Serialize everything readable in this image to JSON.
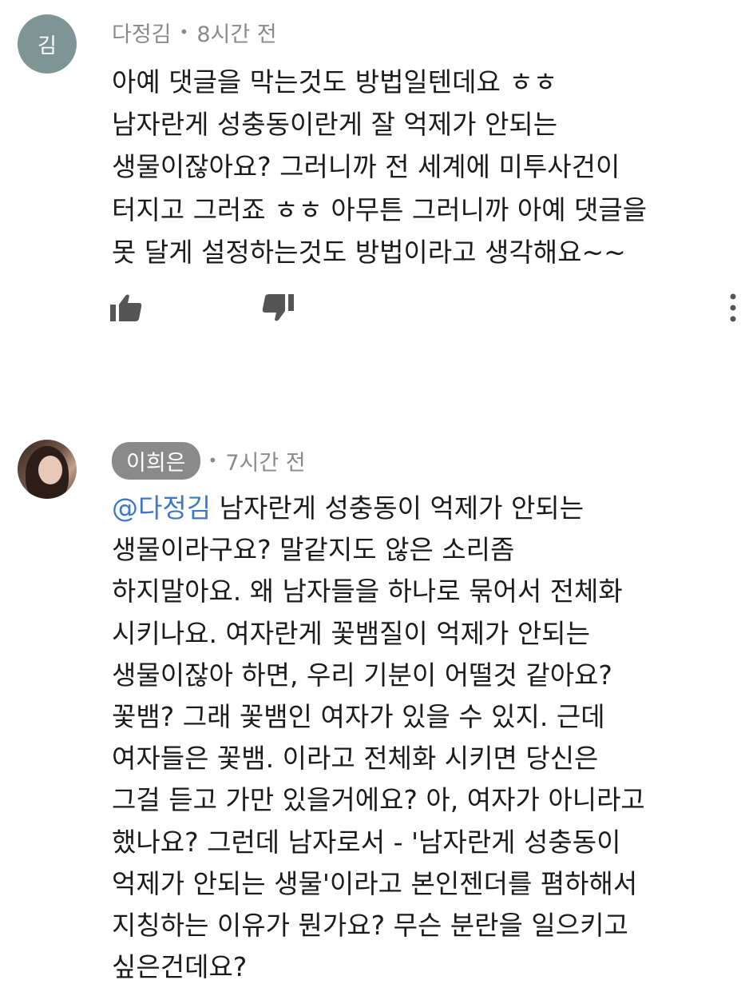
{
  "comments": [
    {
      "avatar_letter": "김",
      "author": "다정김",
      "time": "8시간 전",
      "lines": [
        "아예 댓글을 막는것도 방법일텐데요 ㅎㅎ",
        "남자란게 성충동이란게 잘 억제가 안되는",
        "생물이잖아요? 그러니까 전 세계에 미투사건이",
        "터지고 그러죠 ㅎㅎ 아무튼 그러니까 아예 댓글을",
        "못 달게 설정하는것도 방법이라고 생각해요~~"
      ],
      "actions": {
        "like_icon": "thumbs-up-icon",
        "dislike_icon": "thumbs-down-icon",
        "more_icon": "more-vertical-icon"
      }
    },
    {
      "author": "이희은",
      "time": "7시간 전",
      "mention": "@다정김",
      "first_line_rest": " 남자란게 성충동이 억제가 안되는",
      "lines": [
        "생물이라구요? 말같지도 않은 소리좀",
        "하지말아요. 왜 남자들을 하나로 묶어서 전체화",
        "시키나요. 여자란게 꽃뱀질이 억제가 안되는",
        "생물이잖아 하면, 우리 기분이 어떨것 같아요?",
        "꽃뱀? 그래 꽃뱀인 여자가 있을 수 있지. 근데",
        "여자들은 꽃뱀. 이라고 전체화 시키면 당신은",
        "그걸 듣고 가만 있을거에요? 아, 여자가 아니라고",
        "했나요? 그런데 남자로서 - '남자란게 성충동이",
        "억제가 안되는 생물'이라고 본인젠더를 폄하해서",
        "지칭하는 이유가 뭔가요? 무슨 분란을 일으키고",
        "싶은건데요?"
      ]
    }
  ],
  "separator": "•",
  "colors": {
    "text": "#1b1b1b",
    "meta": "#8a8a8a",
    "mention": "#3d78c4",
    "avatar_bg": "#7e9596"
  }
}
